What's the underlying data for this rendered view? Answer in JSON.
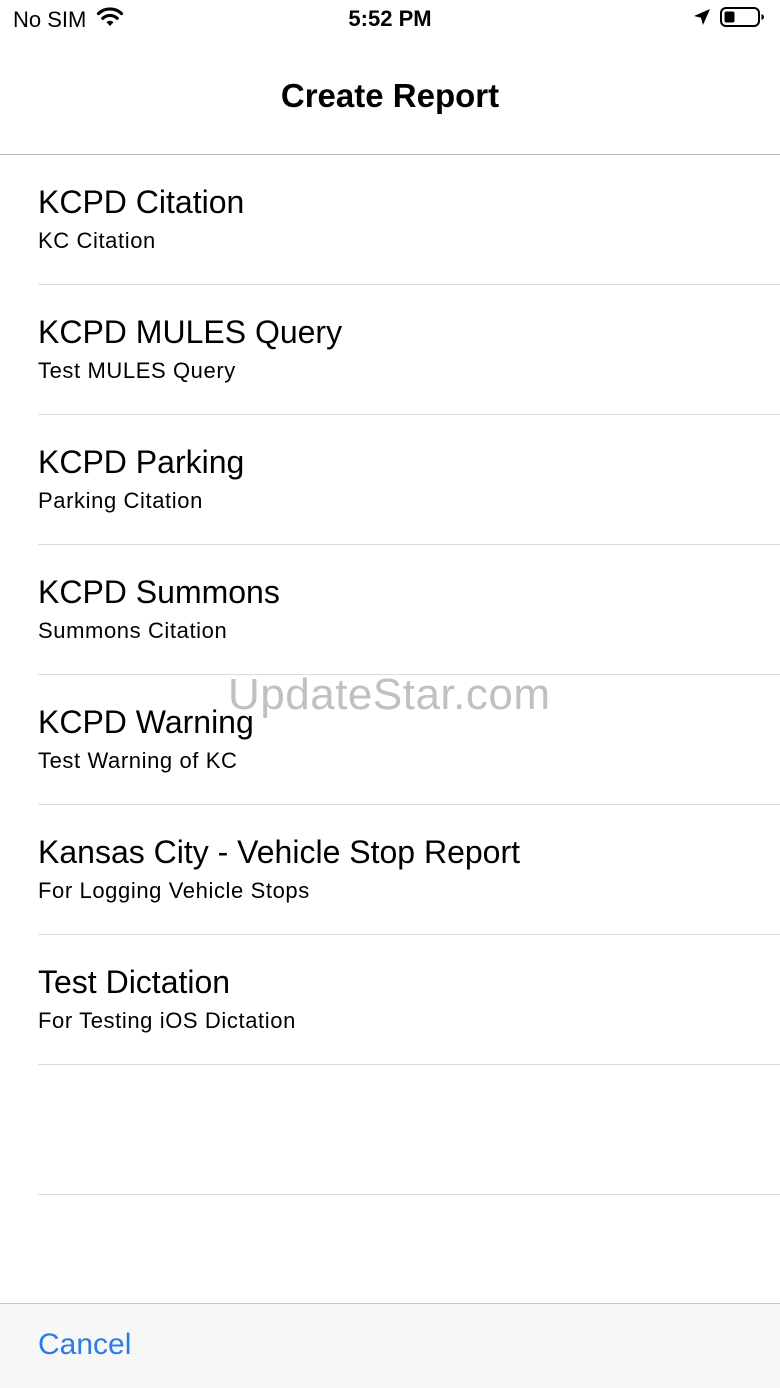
{
  "status_bar": {
    "carrier": "No SIM",
    "time": "5:52 PM"
  },
  "nav": {
    "title": "Create Report"
  },
  "reports": [
    {
      "title": "KCPD Citation",
      "subtitle": "KC Citation"
    },
    {
      "title": "KCPD MULES Query",
      "subtitle": "Test MULES Query"
    },
    {
      "title": "KCPD Parking",
      "subtitle": "Parking Citation"
    },
    {
      "title": "KCPD Summons",
      "subtitle": "Summons Citation"
    },
    {
      "title": "KCPD Warning",
      "subtitle": "Test Warning of KC"
    },
    {
      "title": "Kansas City - Vehicle Stop Report",
      "subtitle": "For Logging Vehicle Stops"
    },
    {
      "title": "Test Dictation",
      "subtitle": "For Testing iOS Dictation"
    }
  ],
  "watermark": "UpdateStar.com",
  "toolbar": {
    "cancel_label": "Cancel"
  },
  "colors": {
    "accent": "#2f7be6",
    "separator": "#dcdce0",
    "toolbar_bg": "#f7f7f7"
  },
  "icons": [
    "wifi-icon",
    "location-arrow-icon",
    "battery-icon"
  ]
}
